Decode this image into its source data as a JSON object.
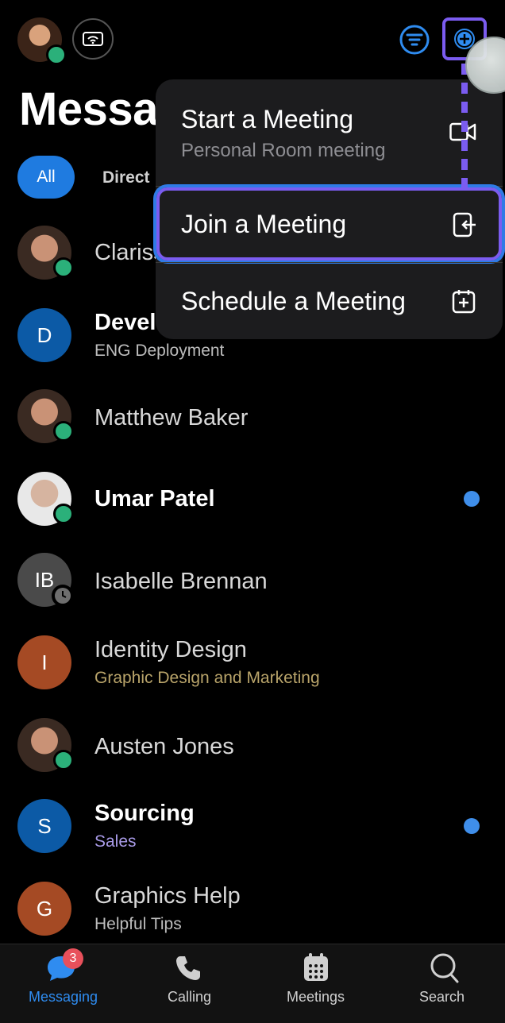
{
  "header": {
    "title": "Messaging"
  },
  "filters": {
    "all": "All",
    "direct": "Direct"
  },
  "conversations": [
    {
      "name": "Clarissa",
      "subtitle": "",
      "avatar_initials": "",
      "bold": false
    },
    {
      "name": "Developers",
      "subtitle": "ENG Deployment",
      "avatar_initials": "D",
      "bold": true
    },
    {
      "name": "Matthew Baker",
      "subtitle": "",
      "avatar_initials": "",
      "bold": false
    },
    {
      "name": "Umar Patel",
      "subtitle": "",
      "avatar_initials": "",
      "bold": true,
      "unread": true
    },
    {
      "name": "Isabelle Brennan",
      "subtitle": "",
      "avatar_initials": "IB",
      "bold": false
    },
    {
      "name": "Identity Design",
      "subtitle": "Graphic Design and Marketing",
      "avatar_initials": "I",
      "bold": false
    },
    {
      "name": "Austen Jones",
      "subtitle": "",
      "avatar_initials": "",
      "bold": false
    },
    {
      "name": "Sourcing",
      "subtitle": "Sales",
      "avatar_initials": "S",
      "bold": true,
      "unread": true
    },
    {
      "name": "Graphics Help",
      "subtitle": "Helpful Tips",
      "avatar_initials": "G",
      "bold": false
    }
  ],
  "menu": {
    "start": {
      "title": "Start a Meeting",
      "subtitle": "Personal Room meeting",
      "icon": "video-icon"
    },
    "join": {
      "title": "Join a Meeting",
      "icon": "join-icon"
    },
    "schedule": {
      "title": "Schedule a Meeting",
      "icon": "calendar-plus-icon"
    }
  },
  "tabs": [
    {
      "label": "Messaging",
      "icon": "chat-icon",
      "badge": "3",
      "active": true
    },
    {
      "label": "Calling",
      "icon": "phone-icon"
    },
    {
      "label": "Meetings",
      "icon": "calendar-icon"
    },
    {
      "label": "Search",
      "icon": "search-icon"
    }
  ],
  "colors": {
    "accent_blue": "#1f7be0",
    "presence_green": "#2bb07a",
    "highlight_purple": "#7b5cf0",
    "badge_red": "#e8505b",
    "identity_design_subtitle": "#b9a46a",
    "sourcing_subtitle": "#a99be8",
    "orange_avatar": "#a54a24",
    "blue_avatar": "#0c5aa6",
    "grey_avatar": "#4a4a4a"
  }
}
